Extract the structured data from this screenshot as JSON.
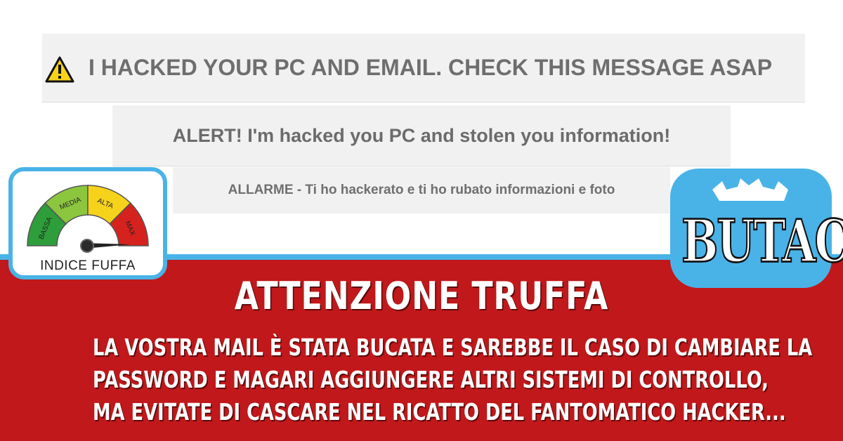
{
  "email_subject": {
    "warning_icon": "warning-triangle-icon",
    "text": "I HACKED YOUR PC AND EMAIL. CHECK THIS MESSAGE ASAP"
  },
  "email_alert": {
    "text": "ALERT! I'm hacked you PC and stolen you information!"
  },
  "italian_translation": {
    "text": "ALLARME - Ti ho hackerato e ti ho rubato informazioni e foto"
  },
  "gauge": {
    "levels": [
      "BASSA",
      "MEDIA",
      "ALTA",
      "MAX"
    ],
    "label": "INDICE FUFFA",
    "level_colors": [
      "#2e9e3a",
      "#8cc63f",
      "#f6d21b",
      "#d6221e"
    ]
  },
  "logo": {
    "text": "BUTAC"
  },
  "banner": {
    "title": "ATTENZIONE TRUFFA",
    "lines": [
      "LA VOSTRA MAIL È STATA BUCATA E SAREBBE IL CASO DI CAMBIARE LA",
      "PASSWORD E MAGARI AGGIUNGERE ALTRI SISTEMI DI CONTROLLO,",
      "MA EVITATE DI CASCARE NEL RICATTO DEL FANTOMATICO HACKER..."
    ]
  },
  "colors": {
    "banner_red": "#c0181b",
    "accent_blue": "#49b3e7",
    "strip_gray": "#f1f1f1",
    "text_gray": "#6e6e6e"
  }
}
